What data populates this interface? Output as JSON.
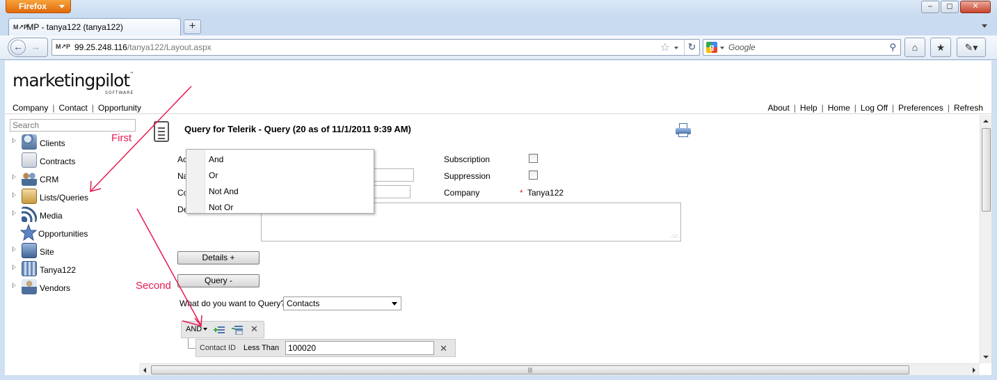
{
  "browser": {
    "app_button": "Firefox",
    "tab_title": "MP - tanya122 (tanya122)",
    "favicon_text": "M↗P",
    "url_host": "99.25.248.116",
    "url_path": "/tanya122/Layout.aspx",
    "search_placeholder": "Google",
    "new_tab": "+"
  },
  "site": {
    "logo": "marketingpilot",
    "logo_tm": "™",
    "logo_sub": "SOFTWARE",
    "left_nav": [
      "Company",
      "Contact",
      "Opportunity"
    ],
    "right_nav": [
      "About",
      "Help",
      "Home",
      "Log Off",
      "Preferences",
      "Refresh"
    ]
  },
  "sidebar": {
    "search_placeholder": "Search",
    "items": [
      {
        "label": "Clients",
        "icon": "clients-icon",
        "expandable": true
      },
      {
        "label": "Contracts",
        "icon": "contracts-icon",
        "expandable": false
      },
      {
        "label": "CRM",
        "icon": "crm-icon",
        "expandable": true
      },
      {
        "label": "Lists/Queries",
        "icon": "lists-queries-icon",
        "expandable": true
      },
      {
        "label": "Media",
        "icon": "media-icon",
        "expandable": true
      },
      {
        "label": "Opportunities",
        "icon": "opportunities-icon",
        "expandable": false
      },
      {
        "label": "Site",
        "icon": "site-icon",
        "expandable": true
      },
      {
        "label": "Tanya122",
        "icon": "tanya122-icon",
        "expandable": true
      },
      {
        "label": "Vendors",
        "icon": "vendors-icon",
        "expandable": true
      }
    ]
  },
  "main": {
    "title": "Query for Telerik - Query (20 as of 11/1/2011 9:39 AM)",
    "labels": {
      "ac": "Ac",
      "na": "Na",
      "co": "Co",
      "de": "De",
      "subscription": "Subscription",
      "suppression": "Suppression",
      "company": "Company",
      "company_required_mark": "*",
      "company_value": "Tanya122"
    },
    "details_button": "Details +",
    "query_button": "Query -",
    "query_prompt": "What do you want to Query?",
    "query_select_value": "Contacts",
    "group_operator": "AND",
    "condition": {
      "field": "Contact ID",
      "operator": "Less Than",
      "value": "100020"
    },
    "close_glyph": "✕"
  },
  "operator_menu": {
    "items": [
      "And",
      "Or",
      "Not And",
      "Not Or"
    ]
  },
  "annotations": {
    "first": "First",
    "second": "Second"
  },
  "colors": {
    "annotation": "#e8194f",
    "firefox_button": "#e87a14"
  }
}
